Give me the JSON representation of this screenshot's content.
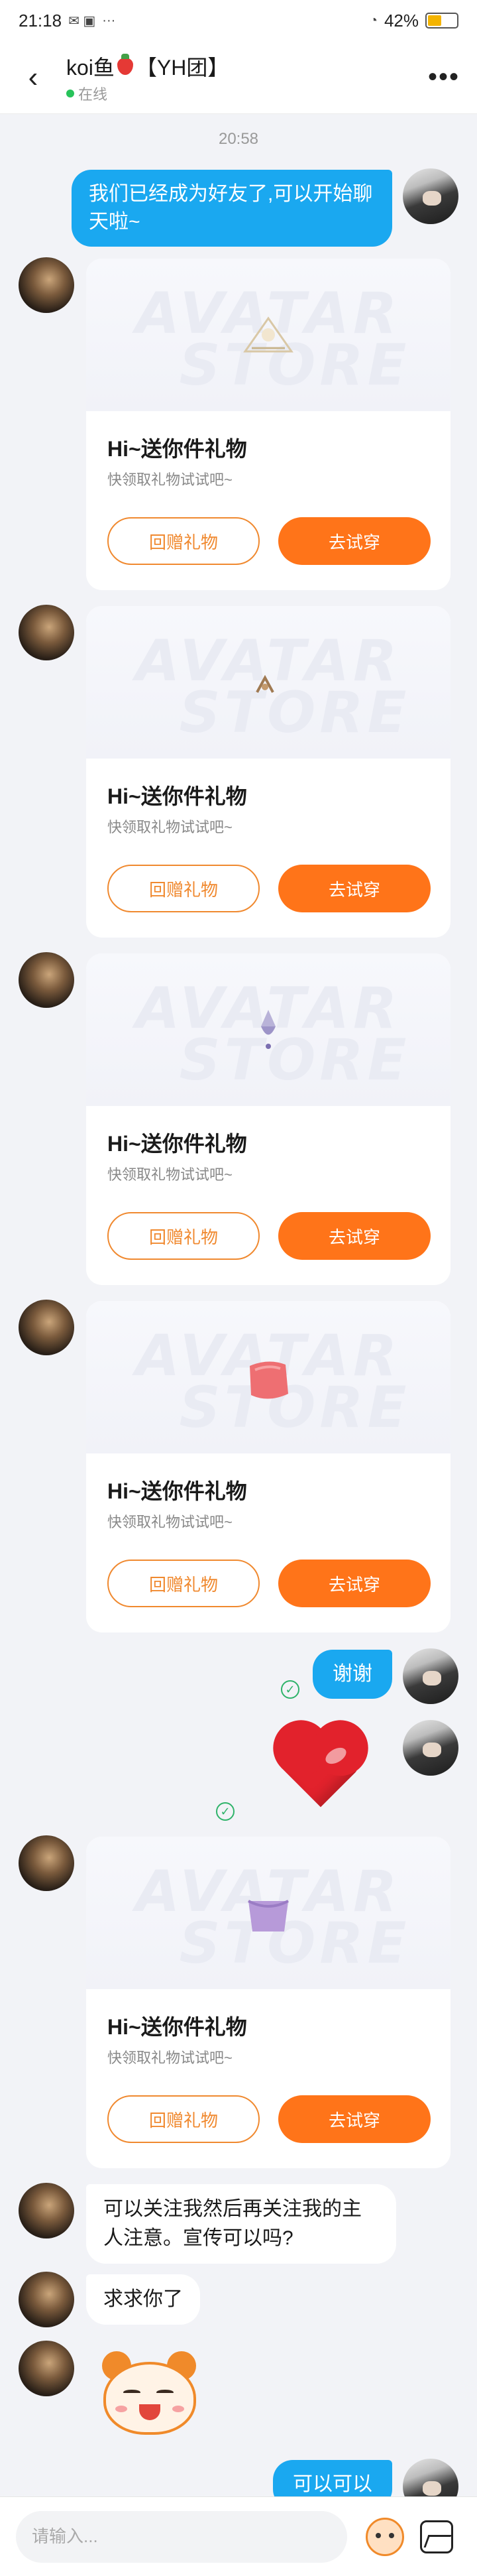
{
  "status_bar": {
    "time": "21:18",
    "extra": "···",
    "battery": "42%",
    "battery_level": 0.42
  },
  "header": {
    "title_prefix": "koi鱼",
    "title_suffix": "【YH团】",
    "online_status": "在线"
  },
  "timestamp": "20:58",
  "messages": {
    "m1": "我们已经成为好友了,可以开始聊天啦~",
    "thanks": "谢谢",
    "follow": "可以关注我然后再关注我的主人注意。宣传可以吗?",
    "beg": "求求你了",
    "ok": "可以可以"
  },
  "gift": {
    "watermark_1": "AVATAR",
    "watermark_2": "STORE",
    "title": "Hi~送你件礼物",
    "subtitle": "快领取礼物试试吧~",
    "return_label": "回赠礼物",
    "try_label": "去试穿"
  },
  "input": {
    "placeholder": "请输入..."
  },
  "colors": {
    "my_bubble": "#1aa8f0",
    "primary_button": "#ff7419",
    "online": "#27c35a"
  }
}
